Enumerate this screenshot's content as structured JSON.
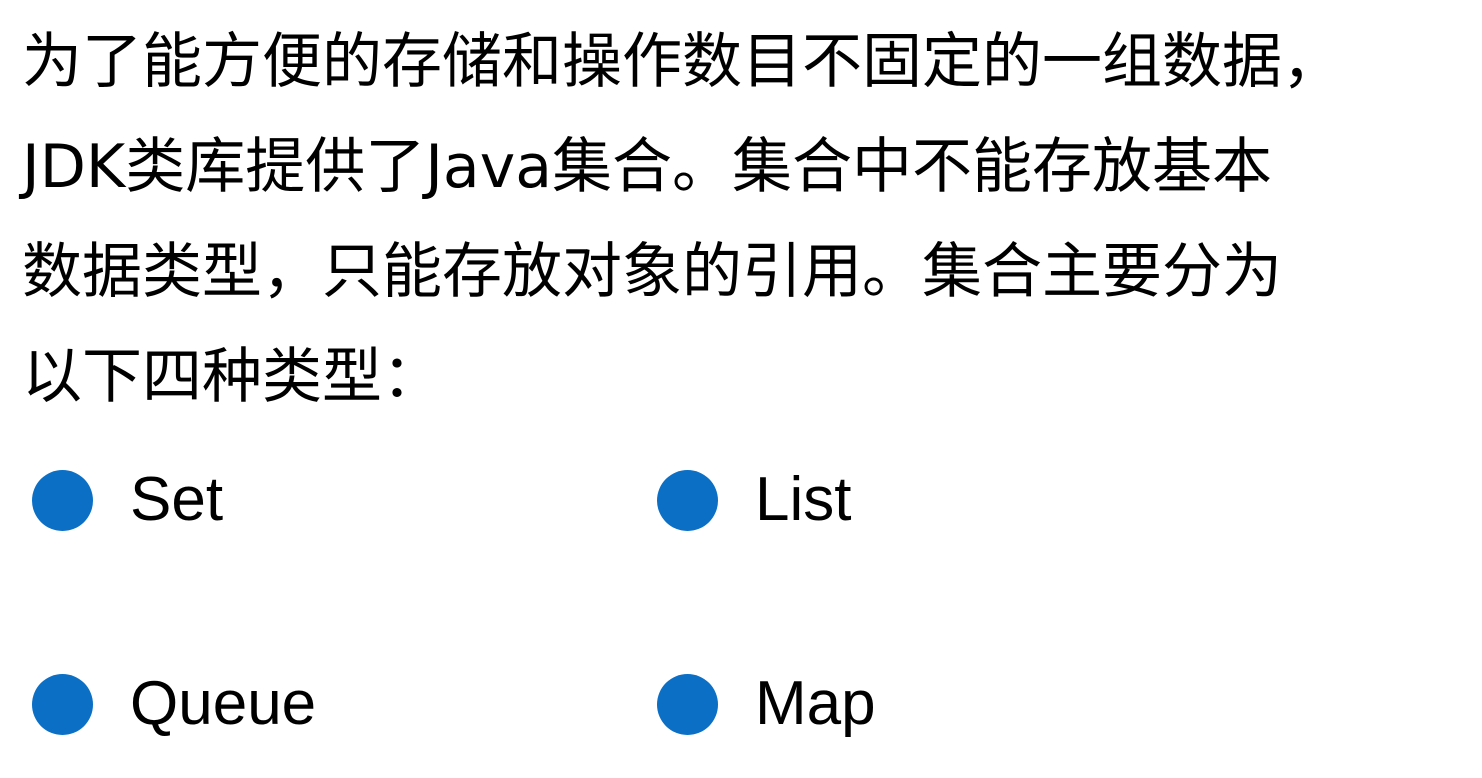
{
  "intro": {
    "lines": [
      "为了能方便的存储和操作数目不固定的一组数据，",
      "JDK类库提供了Java集合。集合中不能存放基本",
      "数据类型，只能存放对象的引用。集合主要分为",
      "以下四种类型："
    ]
  },
  "collection_types": {
    "accent_color": "#0b6fc6",
    "items": [
      {
        "label": "Set"
      },
      {
        "label": "List"
      },
      {
        "label": "Queue"
      },
      {
        "label": "Map"
      }
    ]
  }
}
